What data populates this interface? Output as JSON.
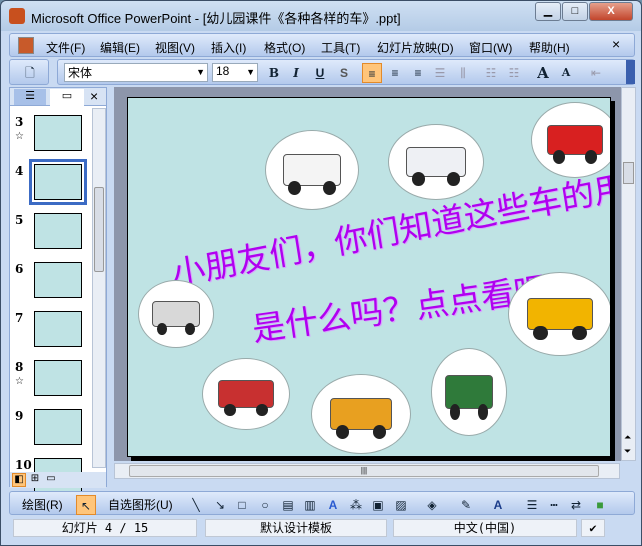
{
  "window": {
    "title": "Microsoft Office PowerPoint - [幼儿园课件《各种各样的车》.ppt]",
    "minimize": "▁",
    "maximize": "□",
    "close": "X"
  },
  "menu": [
    "文件(F)",
    "编辑(E)",
    "视图(V)",
    "插入(I)",
    "格式(O)",
    "工具(T)",
    "幻灯片放映(D)",
    "窗口(W)",
    "帮助(H)"
  ],
  "menu_close": "×",
  "format_toolbar": {
    "font": "宋体",
    "size": "18",
    "bold": "B",
    "italic": "I",
    "underline": "U",
    "shadow": "S",
    "grow": "A",
    "shrink": "A"
  },
  "panel": {
    "close": "×",
    "slides": [
      {
        "n": "3",
        "anim": true
      },
      {
        "n": "4",
        "selected": true
      },
      {
        "n": "5"
      },
      {
        "n": "6"
      },
      {
        "n": "7"
      },
      {
        "n": "8",
        "anim": true
      },
      {
        "n": "9"
      },
      {
        "n": "10"
      }
    ]
  },
  "slide": {
    "line1": "小朋友们，你们知道这些车的用途",
    "line2": "是什么吗？点点看吧",
    "pictures": [
      "ambulance",
      "police-car",
      "fire-truck",
      "school-bus",
      "water-truck",
      "city-bus",
      "garbage-truck",
      "postal-truck"
    ]
  },
  "drawing_toolbar": {
    "draw": "绘图(R)",
    "autoshapes": "自选图形(U)"
  },
  "status": {
    "slide": "幻灯片 4 / 15",
    "template": "默认设计模板",
    "language": "中文(中国)"
  }
}
